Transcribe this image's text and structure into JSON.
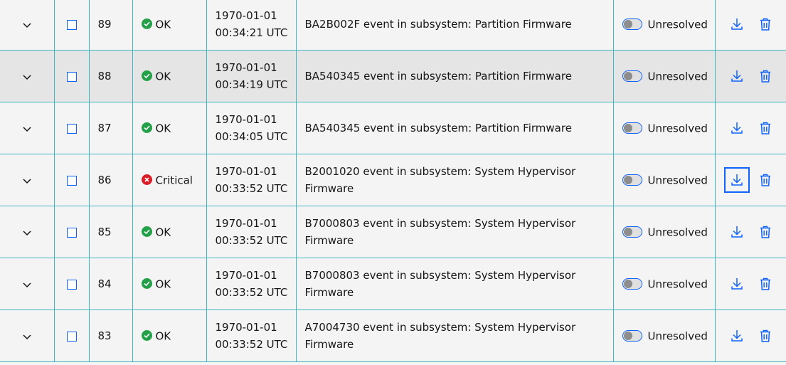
{
  "colors": {
    "ok": "#24a148",
    "critical": "#da1e28",
    "accent": "#0f62fe",
    "border": "#3fb6c0"
  },
  "icons": {
    "expand": "chevron-down-icon",
    "ok": "checkmark-filled-icon",
    "critical": "error-filled-icon",
    "download": "download-icon",
    "delete": "trash-can-icon"
  },
  "rows": [
    {
      "id": "89",
      "severity": "ok",
      "status": "OK",
      "date": "1970-01-01",
      "time": "00:34:21 UTC",
      "description": "BA2B002F event in subsystem: Partition Firmware",
      "resolution": "Unresolved",
      "hover": false,
      "download_focused": false
    },
    {
      "id": "88",
      "severity": "ok",
      "status": "OK",
      "date": "1970-01-01",
      "time": "00:34:19 UTC",
      "description": "BA540345 event in subsystem: Partition Firmware",
      "resolution": "Unresolved",
      "hover": true,
      "download_focused": false
    },
    {
      "id": "87",
      "severity": "ok",
      "status": "OK",
      "date": "1970-01-01",
      "time": "00:34:05 UTC",
      "description": "BA540345 event in subsystem: Partition Firmware",
      "resolution": "Unresolved",
      "hover": false,
      "download_focused": false
    },
    {
      "id": "86",
      "severity": "critical",
      "status": "Critical",
      "date": "1970-01-01",
      "time": "00:33:52 UTC",
      "description": "B2001020 event in subsystem: System Hypervisor Firmware",
      "resolution": "Unresolved",
      "hover": false,
      "download_focused": true
    },
    {
      "id": "85",
      "severity": "ok",
      "status": "OK",
      "date": "1970-01-01",
      "time": "00:33:52 UTC",
      "description": "B7000803 event in subsystem: System Hypervisor Firmware",
      "resolution": "Unresolved",
      "hover": false,
      "download_focused": false
    },
    {
      "id": "84",
      "severity": "ok",
      "status": "OK",
      "date": "1970-01-01",
      "time": "00:33:52 UTC",
      "description": "B7000803 event in subsystem: System Hypervisor Firmware",
      "resolution": "Unresolved",
      "hover": false,
      "download_focused": false
    },
    {
      "id": "83",
      "severity": "ok",
      "status": "OK",
      "date": "1970-01-01",
      "time": "00:33:52 UTC",
      "description": "A7004730 event in subsystem: System Hypervisor Firmware",
      "resolution": "Unresolved",
      "hover": false,
      "download_focused": false
    }
  ]
}
